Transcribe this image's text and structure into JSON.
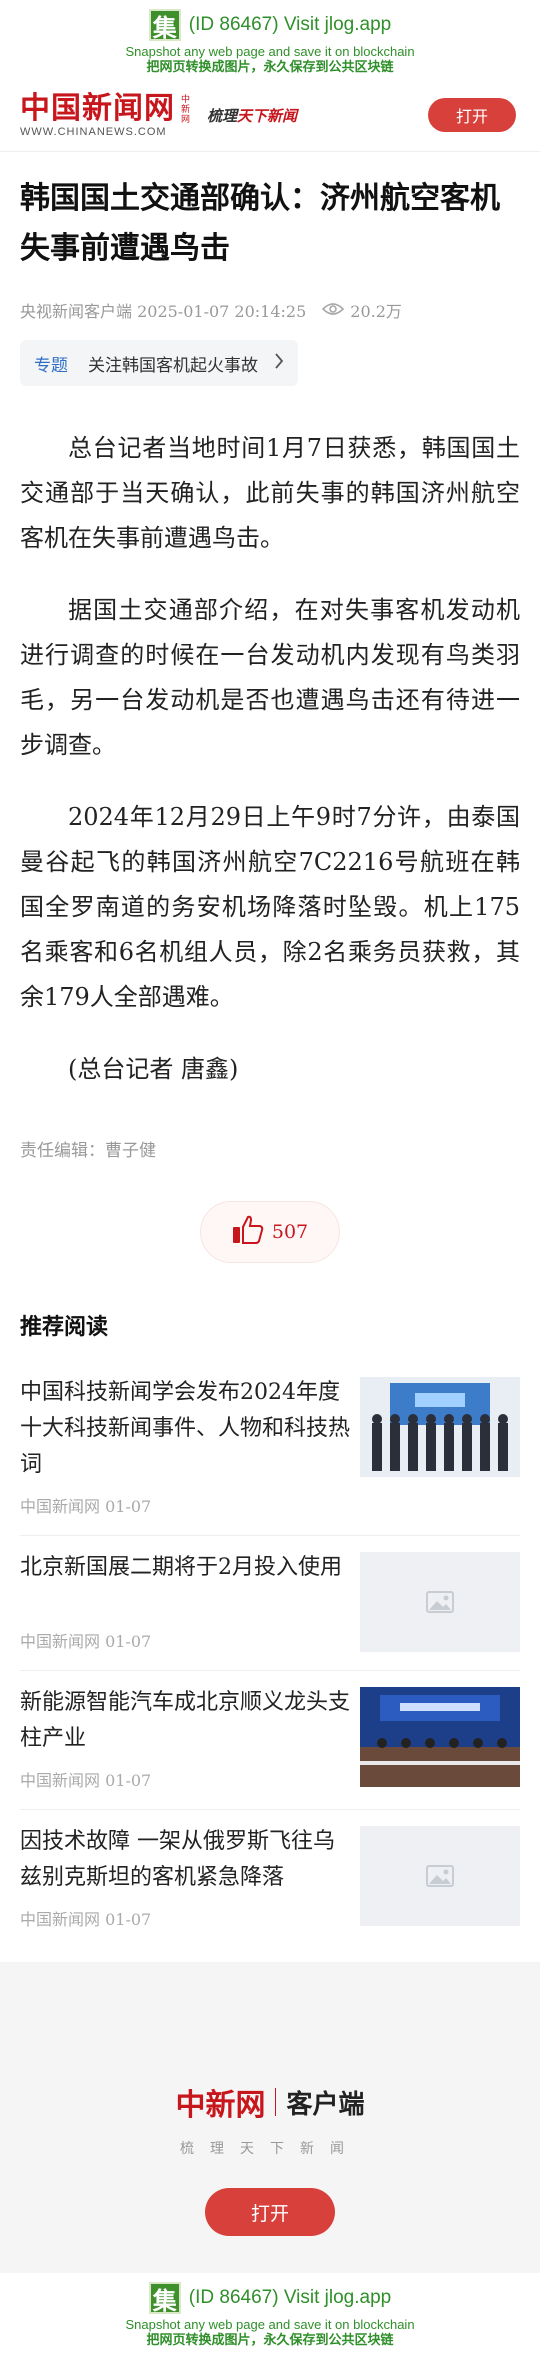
{
  "jlog": {
    "logo": "集",
    "line1": "(ID 86467) Visit jlog.app",
    "line2": "Snapshot any web page and save it on blockchain",
    "line3": "把网页转换成图片，永久保存到公共区块链"
  },
  "header": {
    "brand": "中国新闻网",
    "brand_side": "中新网",
    "brand_url": "WWW.CHINANEWS.COM",
    "slogan_a": "梳理",
    "slogan_b": "天下新闻",
    "open_label": "打开"
  },
  "article": {
    "title": "韩国国土交通部确认：济州航空客机失事前遭遇鸟击",
    "source_time": "央视新闻客户端 2025-01-07 20:14:25",
    "views": "20.2万",
    "topic_tag": "专题",
    "topic_text": "关注韩国客机起火事故",
    "paragraphs": [
      "总台记者当地时间1月7日获悉，韩国国土交通部于当天确认，此前失事的韩国济州航空客机在失事前遭遇鸟击。",
      "据国土交通部介绍，在对失事客机发动机进行调查的时候在一台发动机内发现有鸟类羽毛，另一台发动机是否也遭遇鸟击还有待进一步调查。",
      "2024年12月29日上午9时7分许，由泰国曼谷起飞的韩国济州航空7C2216号航班在韩国全罗南道的务安机场降落时坠毁。机上175名乘客和6名机组人员，除2名乘务员获救，其余179人全部遇难。",
      "(总台记者 唐鑫)"
    ],
    "editor": "责任编辑：曹子健",
    "likes": "507"
  },
  "recommend": {
    "heading": "推荐阅读",
    "items": [
      {
        "title": "中国科技新闻学会发布2024年度十大科技新闻事件、人物和科技热词",
        "source": "中国新闻网 01-07",
        "image": "photo-group"
      },
      {
        "title": "北京新国展二期将于2月投入使用",
        "source": "中国新闻网 01-07",
        "image": "placeholder"
      },
      {
        "title": "新能源智能汽车成北京顺义龙头支柱产业",
        "source": "中国新闻网 01-07",
        "image": "photo-conference"
      },
      {
        "title": "因技术故障 一架从俄罗斯飞往乌兹别克斯坦的客机紧急降落",
        "source": "中国新闻网 01-07",
        "image": "placeholder"
      }
    ]
  },
  "footer": {
    "brand": "中新网",
    "app": "客户端",
    "tagline": "梳理天下新闻",
    "open_label": "打开"
  },
  "colors": {
    "brand_red": "#c8161d",
    "button_red": "#d8403c",
    "jlog_green": "#2f8f2a",
    "link_blue": "#2f6fc6"
  }
}
